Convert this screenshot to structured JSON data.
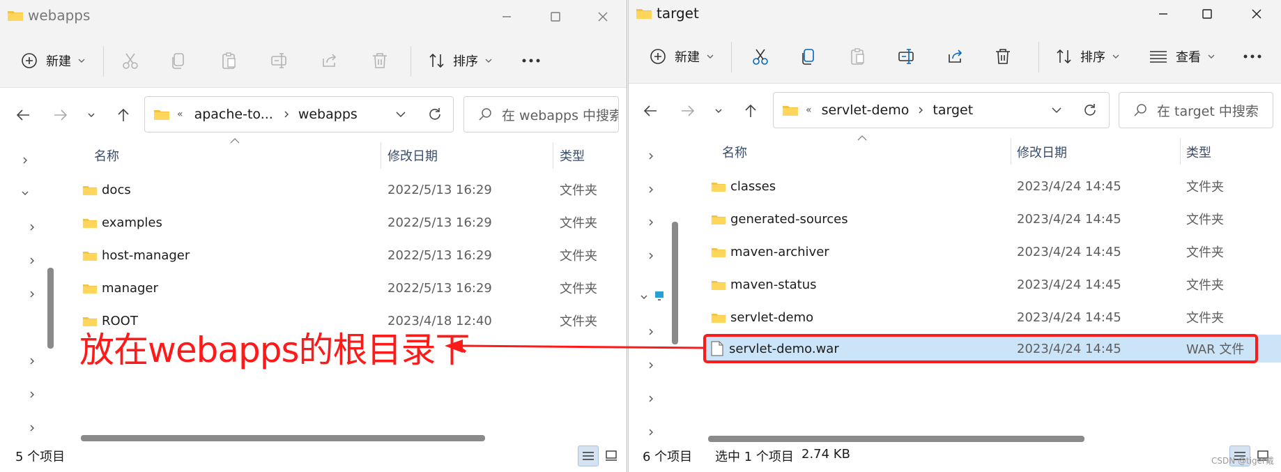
{
  "colors": {
    "accent": "#0067c0",
    "folder": "#f5c141",
    "selection": "#cce4f7",
    "annotation": "#ff1a1a"
  },
  "left_window": {
    "title": "webapps",
    "toolbar": {
      "new_label": "新建",
      "sort_label": "排序"
    },
    "breadcrumb": {
      "chevrons": "«",
      "part1": "apache-to...",
      "part2": "webapps"
    },
    "search_placeholder": "在 webapps 中搜索",
    "columns": {
      "name": "名称",
      "date": "修改日期",
      "type": "类型"
    },
    "rows": [
      {
        "name": "docs",
        "date": "2022/5/13 16:29",
        "type": "文件夹"
      },
      {
        "name": "examples",
        "date": "2022/5/13 16:29",
        "type": "文件夹"
      },
      {
        "name": "host-manager",
        "date": "2022/5/13 16:29",
        "type": "文件夹"
      },
      {
        "name": "manager",
        "date": "2022/5/13 16:29",
        "type": "文件夹"
      },
      {
        "name": "ROOT",
        "date": "2023/4/18 12:40",
        "type": "文件夹"
      }
    ],
    "status": "5 个项目"
  },
  "right_window": {
    "title": "target",
    "toolbar": {
      "new_label": "新建",
      "sort_label": "排序",
      "view_label": "查看"
    },
    "breadcrumb": {
      "chevrons": "«",
      "part1": "servlet-demo",
      "part2": "target"
    },
    "search_placeholder": "在 target 中搜索",
    "columns": {
      "name": "名称",
      "date": "修改日期",
      "type": "类型"
    },
    "rows": [
      {
        "name": "classes",
        "date": "2023/4/24 14:45",
        "type": "文件夹"
      },
      {
        "name": "generated-sources",
        "date": "2023/4/24 14:45",
        "type": "文件夹"
      },
      {
        "name": "maven-archiver",
        "date": "2023/4/24 14:45",
        "type": "文件夹"
      },
      {
        "name": "maven-status",
        "date": "2023/4/24 14:45",
        "type": "文件夹"
      },
      {
        "name": "servlet-demo",
        "date": "2023/4/24 14:45",
        "type": "文件夹"
      },
      {
        "name": "servlet-demo.war",
        "date": "2023/4/24 14:45",
        "type": "WAR 文件"
      }
    ],
    "status_count": "6 个项目",
    "status_selected": "选中 1 个项目",
    "status_size": "2.74 KB"
  },
  "annotation": "放在webapps的根目录下",
  "watermark": "CSDN @tiger戴"
}
